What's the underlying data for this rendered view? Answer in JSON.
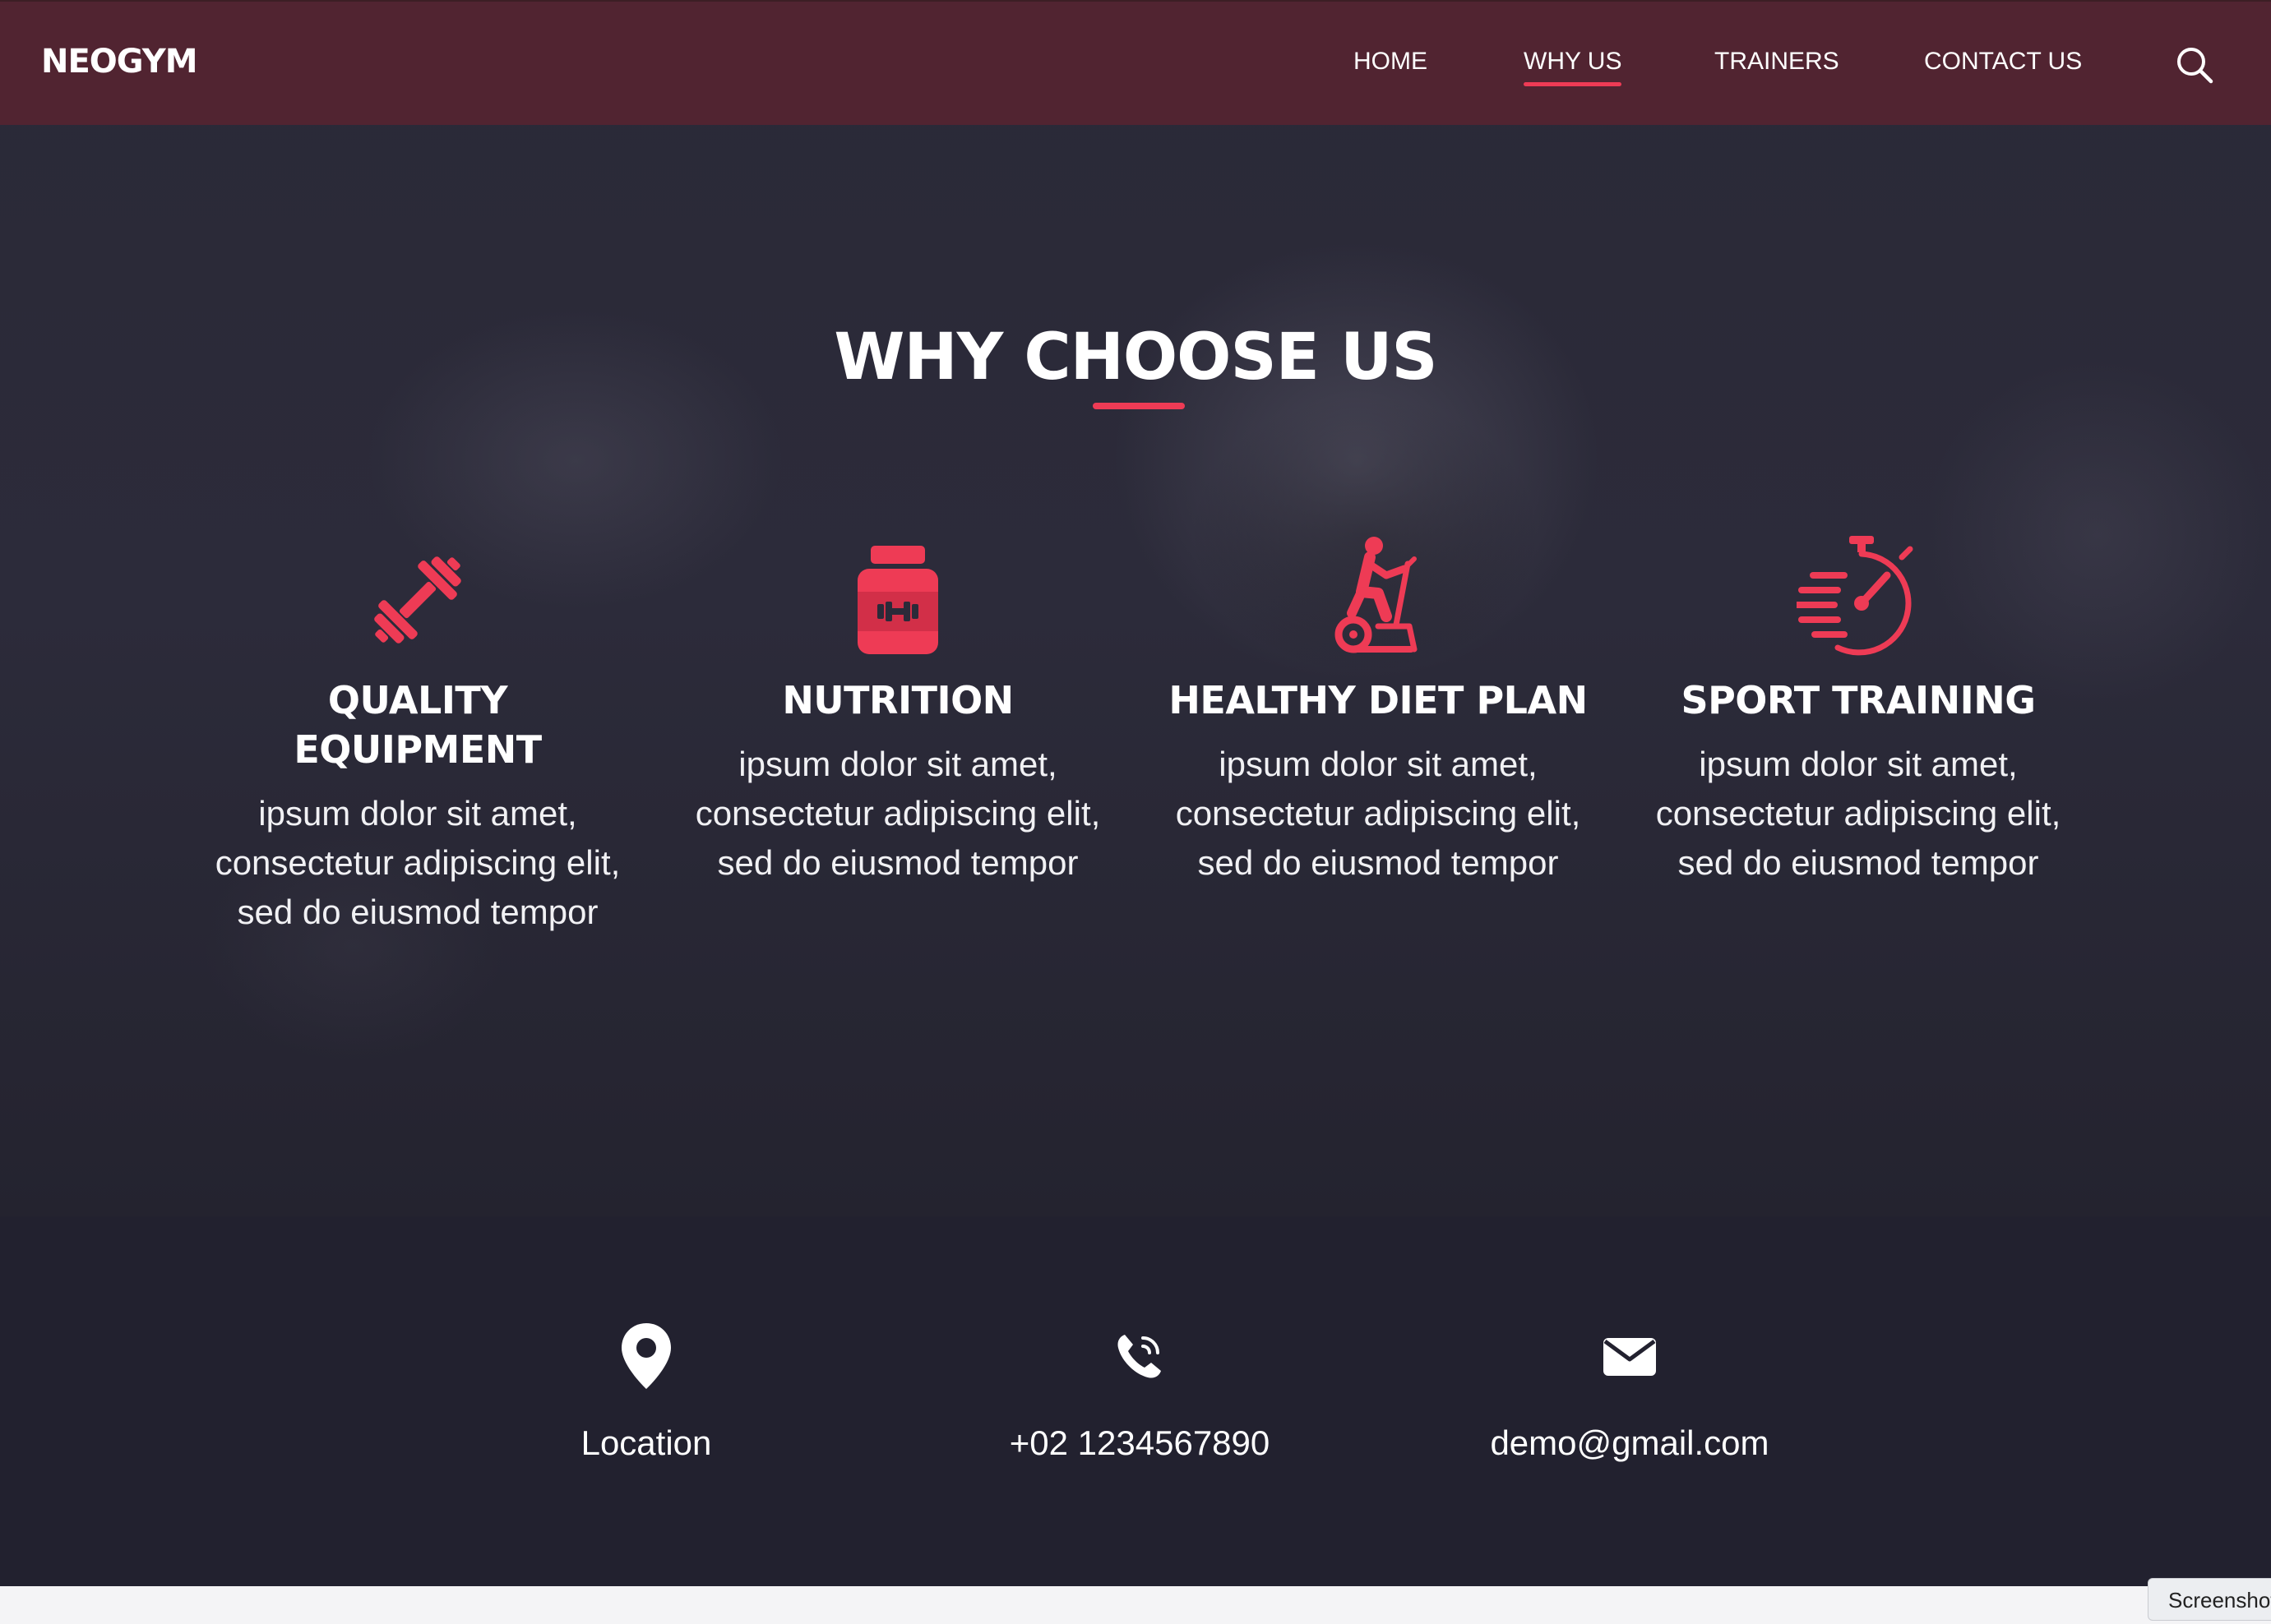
{
  "brand": "NEOGYM",
  "nav": {
    "items": [
      {
        "label": "HOME",
        "active": false
      },
      {
        "label": "WHY US",
        "active": true
      },
      {
        "label": "TRAINERS",
        "active": false
      },
      {
        "label": "CONTACT US",
        "active": false
      }
    ],
    "search_icon": "search-icon"
  },
  "why": {
    "title": "WHY CHOOSE US",
    "features": [
      {
        "icon": "barbell-icon",
        "title": "QUALITY EQUIPMENT",
        "text": "ipsum dolor sit amet, consectetur adipiscing elit, sed do eiusmod tempor"
      },
      {
        "icon": "supplement-jar-icon",
        "title": "NUTRITION",
        "text": "ipsum dolor sit amet, consectetur adipiscing elit, sed do eiusmod tempor"
      },
      {
        "icon": "elliptical-trainer-icon",
        "title": "HEALTHY DIET PLAN",
        "text": "ipsum dolor sit amet, consectetur adipiscing elit, sed do eiusmod tempor"
      },
      {
        "icon": "stopwatch-icon",
        "title": "SPORT TRAINING",
        "text": "ipsum dolor sit amet, consectetur adipiscing elit, sed do eiusmod tempor"
      }
    ]
  },
  "contact": {
    "location": "Location",
    "phone": "+02 1234567890",
    "email": "demo@gmail.com"
  },
  "screenshot_tag": "Screenshot",
  "colors": {
    "accent": "#ee3b55",
    "header": "#542430",
    "background": "#22212f"
  }
}
